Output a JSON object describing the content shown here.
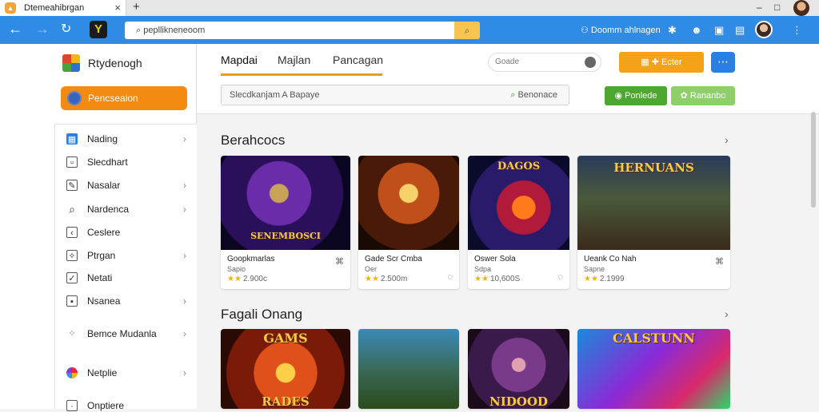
{
  "browser": {
    "tab_title": "Dtemeahibrgan",
    "new_tab_symbol": "+",
    "close_symbol": "×",
    "url": "pepllikneneoom",
    "account_label": "Doomm ahlnagen"
  },
  "sidebar": {
    "brand": "Rtydenogh",
    "primary_button": "Pencseaion",
    "items": [
      {
        "label": "Nading",
        "chevron": true
      },
      {
        "label": "Slecdhart",
        "chevron": false
      },
      {
        "label": "Nasalar",
        "chevron": true
      },
      {
        "label": "Nardenca",
        "chevron": true
      },
      {
        "label": "Ceslere",
        "chevron": false
      },
      {
        "label": "Ptrgan",
        "chevron": true
      },
      {
        "label": "Netati",
        "chevron": false
      },
      {
        "label": "Nsanea",
        "chevron": true
      },
      {
        "label": "Bemce Mudanla",
        "chevron": true
      },
      {
        "label": "Netplie",
        "chevron": true
      },
      {
        "label": "Onptiere",
        "chevron": false
      }
    ]
  },
  "header": {
    "tabs": [
      "Mapdai",
      "Majlan",
      "Pancagan"
    ],
    "mini_search": "Goade",
    "orange_button": "Ecter",
    "filter_text": "Slecdkanjam A Bapaye",
    "filter_right": "Benonace",
    "green_button_1": "Ponlede",
    "green_button_2": "Rananbo"
  },
  "sections": [
    {
      "title": "Berahcocs",
      "cards": [
        {
          "overlay": "SENEMBOSCI",
          "name": "Goopkmarlas",
          "dev": "Sapio",
          "rating": "★★",
          "count": "2.900c"
        },
        {
          "overlay": "",
          "name": "Gade Scr Cmba",
          "dev": "Oer",
          "rating": "★★",
          "count": "2.500m"
        },
        {
          "overlay": "DAGOS",
          "name": "Oswer Sola",
          "dev": "Sdpa",
          "rating": "★★",
          "count": "10,600S"
        },
        {
          "overlay": "HERNUANS",
          "name": "Ueank Co Nah",
          "dev": "Sapne",
          "rating": "★★",
          "count": "2.1999"
        }
      ]
    },
    {
      "title": "Fagali Onang",
      "cards": [
        {
          "overlay": "GAMS",
          "overlay2": "RADES"
        },
        {
          "overlay": ""
        },
        {
          "overlay": "NIDOOD"
        },
        {
          "overlay": "CALSTUNN"
        }
      ]
    }
  ],
  "colors": {
    "accent_orange": "#f38a12",
    "address_blue": "#2f8be3",
    "green": "#5ab230"
  }
}
